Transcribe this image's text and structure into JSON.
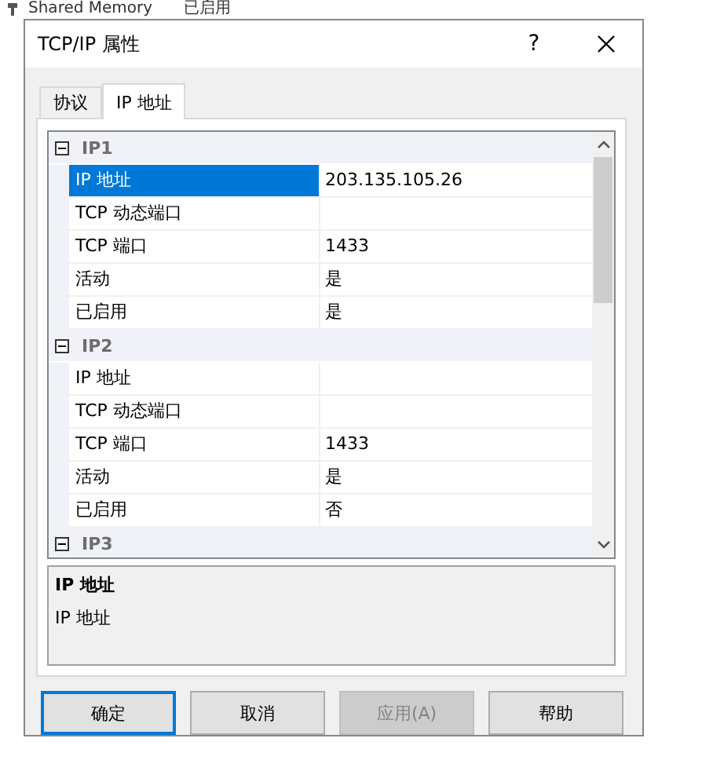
{
  "background": {
    "items": [
      {
        "name": "Shared Memory",
        "status": "已启用"
      }
    ]
  },
  "window": {
    "title": "TCP/IP 属性",
    "help": "?"
  },
  "tabs": [
    {
      "label": "协议",
      "selected": false
    },
    {
      "label": "IP 地址",
      "selected": true
    }
  ],
  "groups": [
    {
      "name": "IP1",
      "expanded": true,
      "properties": [
        {
          "name": "IP 地址",
          "value": "203.135.105.26",
          "selected": true
        },
        {
          "name": "TCP 动态端口",
          "selected": false
        },
        {
          "name": "TCP 端口",
          "value": "1433",
          "selected": false
        },
        {
          "name": "活动",
          "value": "是",
          "selected": false
        },
        {
          "name": "已启用",
          "value": "是",
          "selected": false
        }
      ]
    },
    {
      "name": "IP2",
      "expanded": true,
      "properties": [
        {
          "name": "IP 地址",
          "selected": false
        },
        {
          "name": "TCP 动态端口",
          "selected": false
        },
        {
          "name": "TCP 端口",
          "value": "1433",
          "selected": false
        },
        {
          "name": "活动",
          "value": "是",
          "selected": false
        },
        {
          "name": "已启用",
          "value": "否",
          "selected": false
        }
      ]
    },
    {
      "name": "IP3",
      "expanded": true
    }
  ],
  "description": {
    "title": "IP 地址",
    "text": "IP 地址"
  },
  "buttons": [
    {
      "label": "确定",
      "default": true,
      "disabled": false
    },
    {
      "label": "取消",
      "default": false,
      "disabled": false
    },
    {
      "label": "应用(A)",
      "default": false,
      "disabled": true
    },
    {
      "label": "帮助",
      "default": false,
      "disabled": false
    }
  ]
}
